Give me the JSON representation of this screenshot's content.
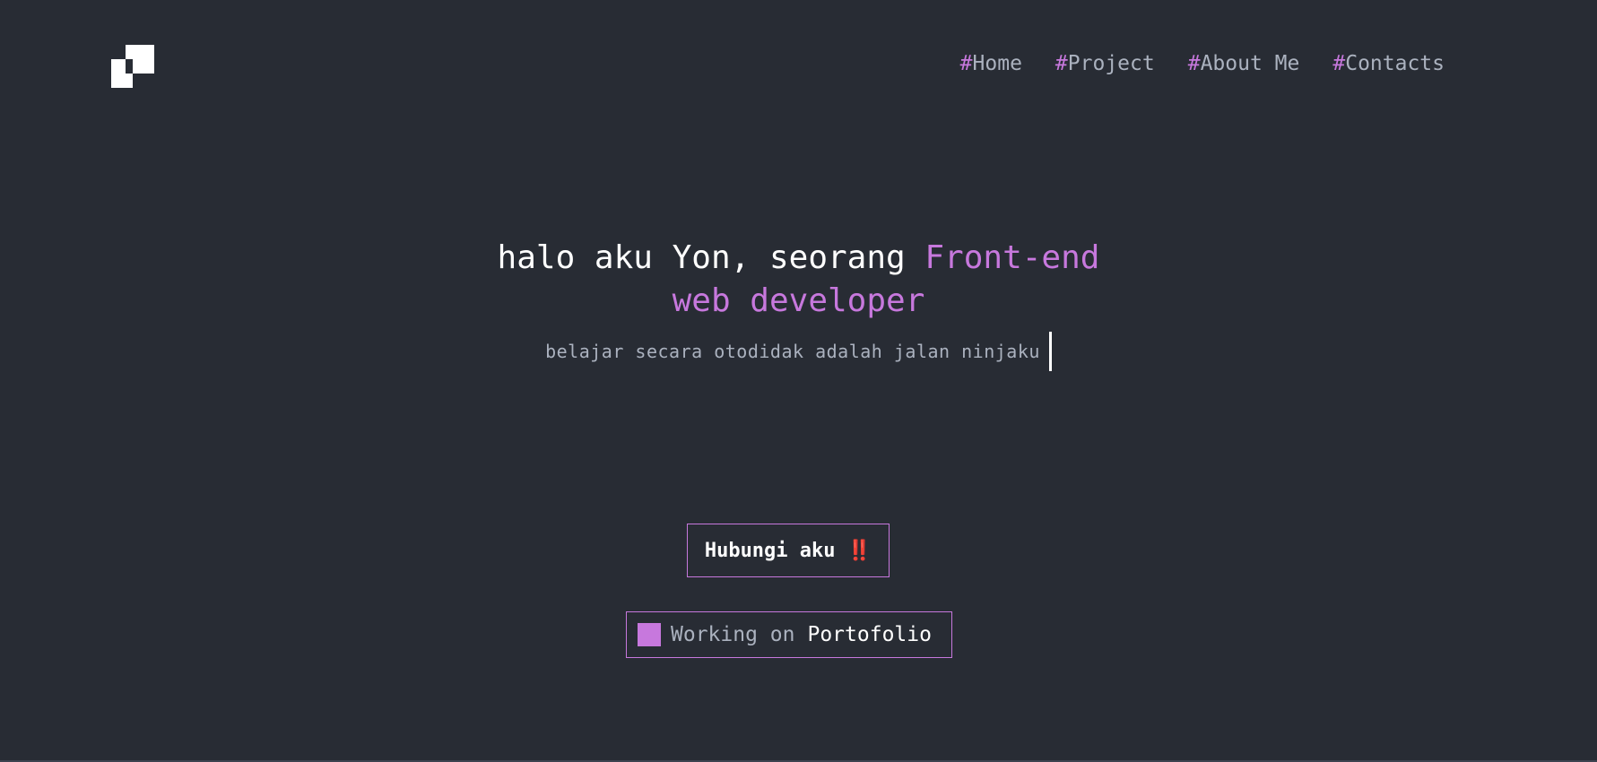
{
  "header": {
    "logo_icon": "pixel-logo-icon",
    "nav": [
      {
        "hash": "#",
        "label": "Home"
      },
      {
        "hash": "#",
        "label": "Project"
      },
      {
        "hash": "#",
        "label": "About Me"
      },
      {
        "hash": "#",
        "label": "Contacts"
      }
    ]
  },
  "hero": {
    "title_prefix": "halo aku Yon, seorang ",
    "title_accent_1": "Front-end",
    "title_accent_2": "web developer",
    "tagline": "belajar secara otodidak adalah jalan ninjaku",
    "caret_icon": "text-cursor-icon"
  },
  "cta": {
    "label": "Hubungi aku ‼️"
  },
  "status": {
    "square_icon": "status-square-icon",
    "prefix": "Working on",
    "strong": "Portofolio"
  },
  "colors": {
    "background": "#282c34",
    "accent": "#c778dd",
    "text": "#abb2bf",
    "white": "#ffffff"
  }
}
